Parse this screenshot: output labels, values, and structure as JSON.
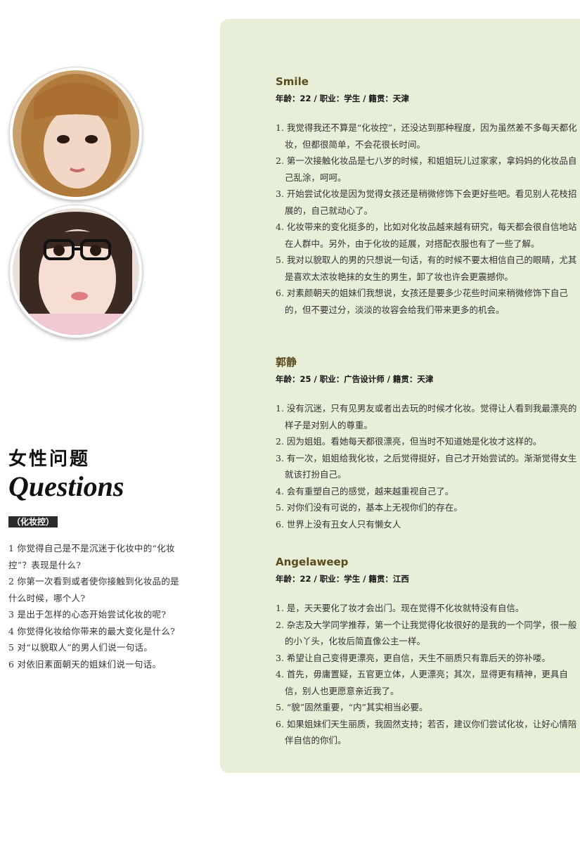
{
  "left": {
    "title_cn": "女性问题",
    "title_en": "Questions",
    "tag": "（化妆控）",
    "questions": [
      "1 你觉得自己是不是沉迷于化妆中的“化妆",
      "控”？表现是什么?",
      "2 你第一次看到或者使你接触到化妆品的是",
      "什么时候，哪个人?",
      "3 是出于怎样的心态开始尝试化妆的呢?",
      "4 你觉得化妆给你带来的最大变化是什么?",
      "5 对“以貌取人”的男人们说一句话。",
      "6 对依旧素面朝天的姐妹们说一句话。"
    ]
  },
  "avatars": [
    {
      "name": "avatar-smile",
      "hair": "#b07a3a",
      "skin": "#f3d7c6",
      "bg": "#c9a06b"
    },
    {
      "name": "avatar-glasses",
      "hair": "#3a2a22",
      "skin": "#f6dfd2",
      "bg": "#e9e2dc"
    }
  ],
  "profiles": [
    {
      "name": "Smile",
      "info": "年龄：22 / 职业：学生 / 籍贯：天津",
      "answers": [
        "1. 我觉得我还不算是“化妆控”，还没达到那种程度，因为虽然差不多每天都化妆，但都很简单，不会花很长时间。",
        "2. 第一次接触化妆品是七八岁的时候，和姐姐玩儿过家家，拿妈妈的化妆品自己乱涂，呵呵。",
        "3. 开始尝试化妆是因为觉得女孩还是稍微修饰下会更好些吧。看见别人花枝招展的，自己就动心了。",
        "4. 化妆带来的变化挺多的，比如对化妆品越来越有研究，每天都会很自信地站在人群中。另外，由于化妆的延展，对搭配衣服也有了一些了解。",
        "5. 我对以貌取人的男的只想说一句话，有的时候不要太相信自己的眼睛，尤其是喜欢太浓妆艳抹的女生的男生，卸了妆也许会更震撼你。",
        "6. 对素颜朝天的姐妹们我想说，女孩还是要多少花些时间来稍微修饰下自己的，但不要过分，淡淡的妆容会给我们带来更多的机会。"
      ]
    },
    {
      "name": "郭静",
      "info": "年龄：25 / 职业：广告设计师 / 籍贯：天津",
      "answers": [
        "1. 没有沉迷，只有见男友或者出去玩的时候才化妆。觉得让人看到我最漂亮的样子是对别人的尊重。",
        "2. 因为姐姐。看她每天都很漂亮，但当时不知道她是化妆才这样的。",
        "3. 有一次，姐姐给我化妆，之后觉得挺好，自己才开始尝试的。渐渐觉得女生就该打扮自己。",
        "4. 会有重塑自己的感觉，越来越重视自己了。",
        "5. 对你们没有可说的，基本上无视你们的存在。",
        "6. 世界上没有丑女人只有懒女人"
      ]
    },
    {
      "name": "Angelaweep",
      "info": "年龄：22 / 职业：学生 / 籍贯：江西",
      "answers": [
        "1. 是，天天要化了妆才会出门。现在觉得不化妆就特没有自信。",
        "2. 杂志及大学同学推荐，第一个让我觉得化妆很好的是我的一个同学，很一般的小丫头，化妆后简直像公主一样。",
        "3. 希望让自己变得更漂亮，更自信，天生不丽质只有靠后天的弥补喽。",
        "4. 首先，毋庸置疑，五官更立体，人更漂亮；其次，显得更有精神，更具自信，别人也更愿意亲近我了。",
        "5. “貌”固然重要，“内”其实相当必要。",
        "6. 如果姐妹们天生丽质，我固然支持；若否，建议你们尝试化妆，让好心情陪伴自信的你们。"
      ]
    }
  ]
}
